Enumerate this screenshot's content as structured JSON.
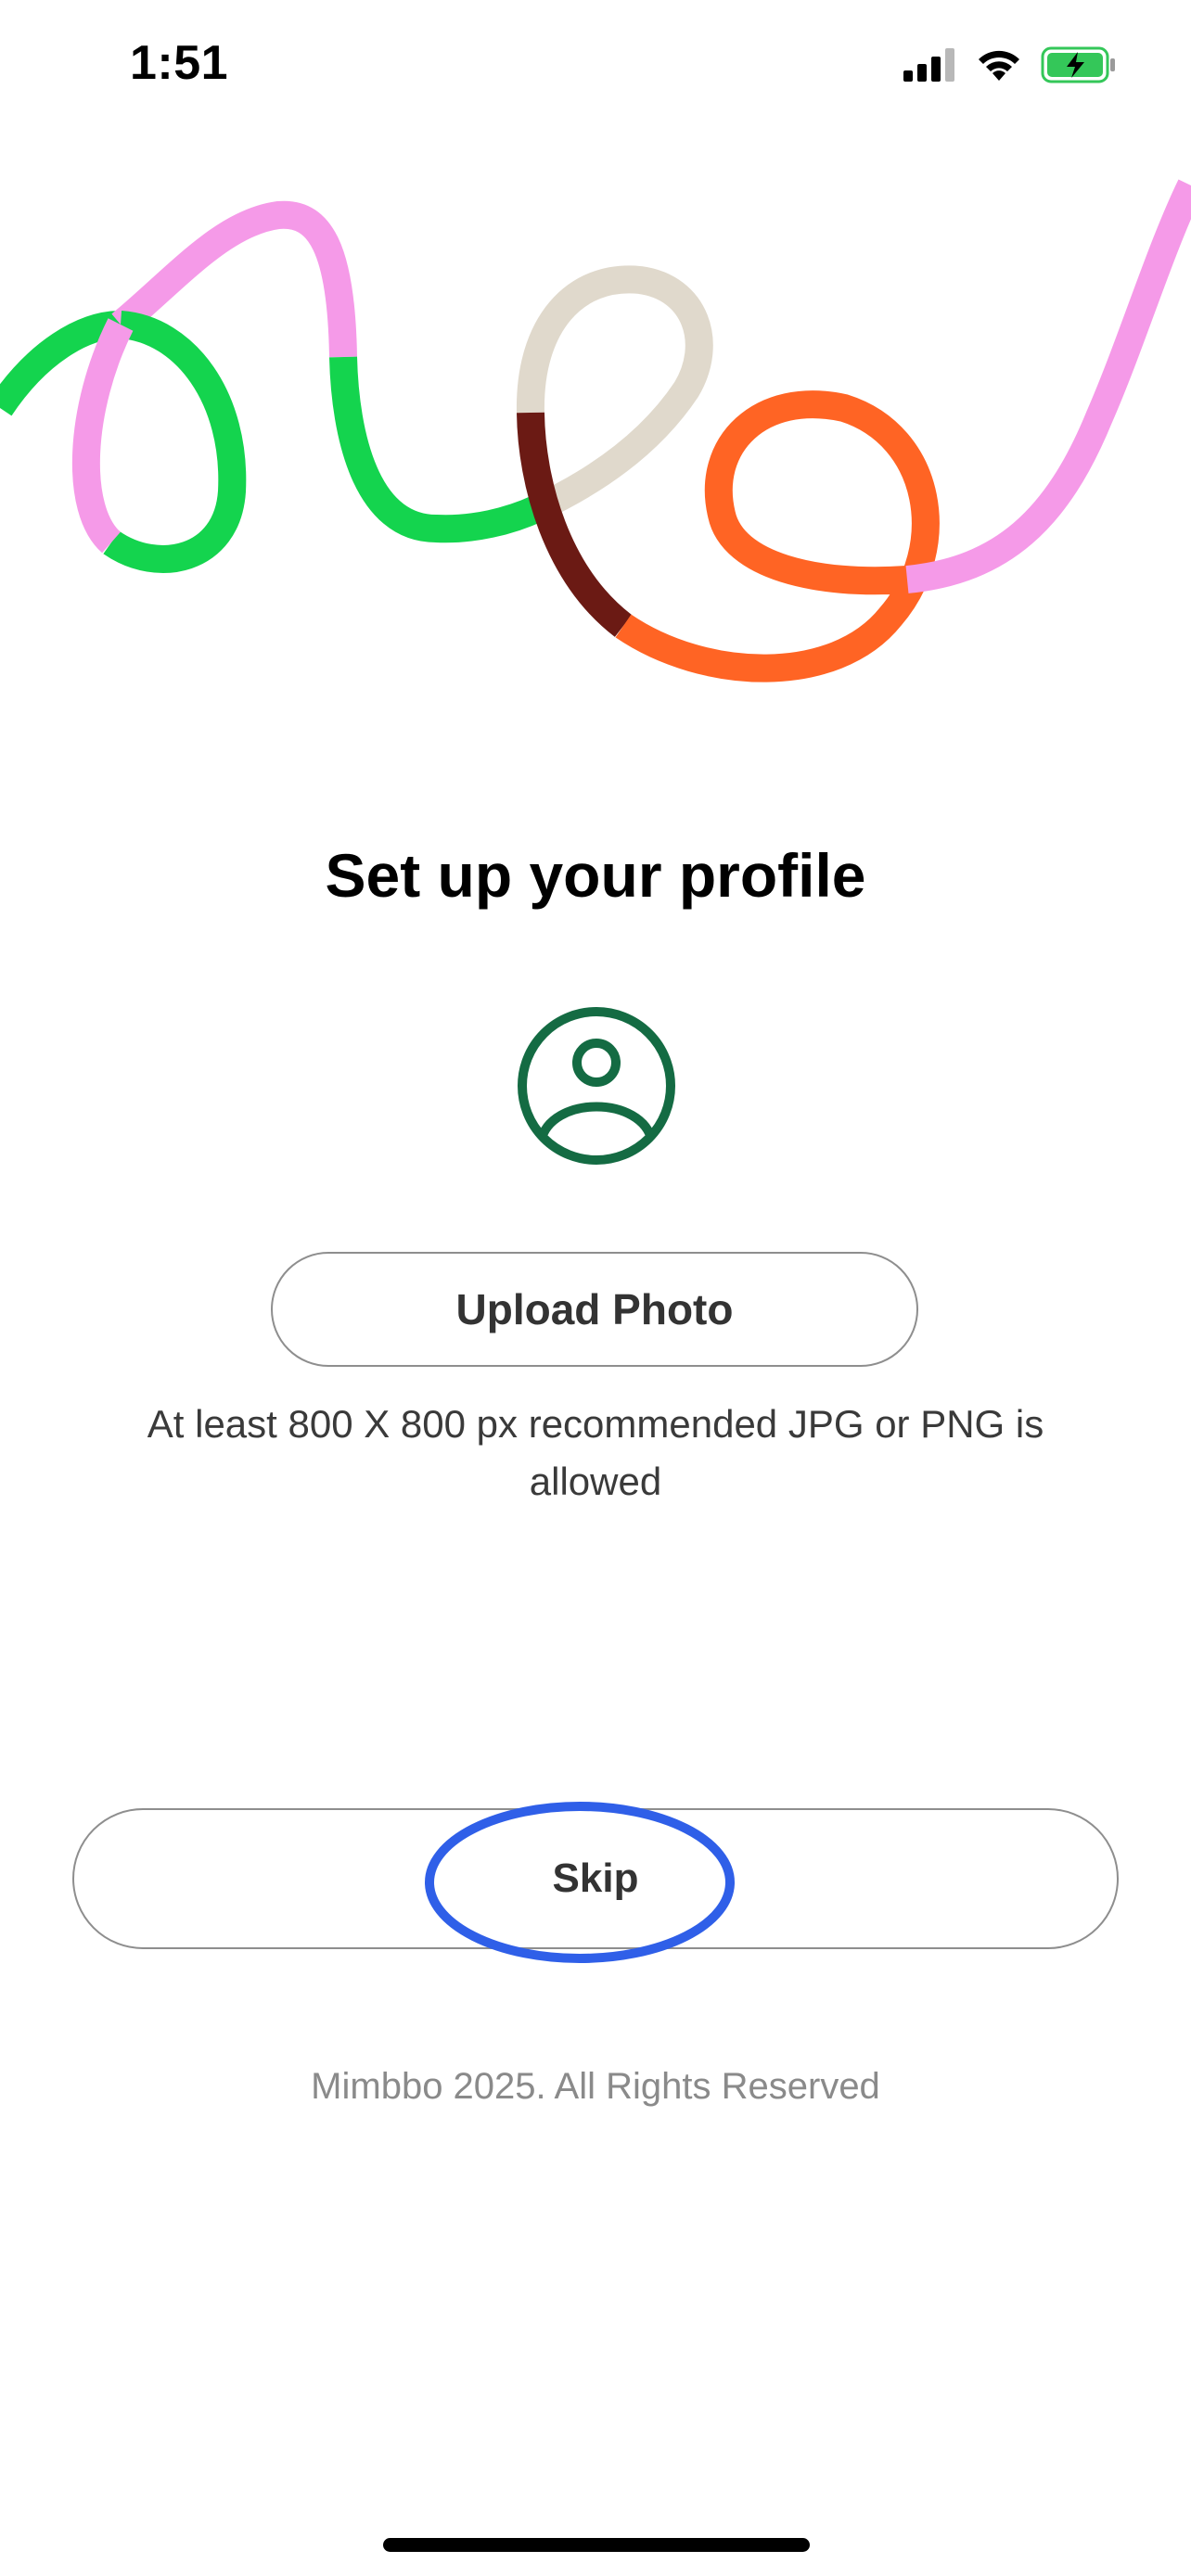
{
  "status_bar": {
    "time": "1:51",
    "icons": [
      "signal-icon",
      "wifi-icon",
      "battery-charging-icon"
    ]
  },
  "main": {
    "title": "Set up your profile",
    "avatar_icon": "user-circle-icon",
    "upload_label": "Upload Photo",
    "hint": "At least 800 X 800 px recommended JPG or PNG is allowed",
    "skip_label": "Skip"
  },
  "footer": {
    "text": "Mimbbo 2025. All Rights Reserved"
  },
  "colors": {
    "avatar": "#146b43",
    "highlight": "#2f5fe8",
    "battery": "#34c759",
    "doodle_pink": "#f59ae8",
    "doodle_green": "#14d44e",
    "doodle_beige": "#e0d9cc",
    "doodle_maroon": "#6b1a14",
    "doodle_orange": "#ff6424"
  }
}
